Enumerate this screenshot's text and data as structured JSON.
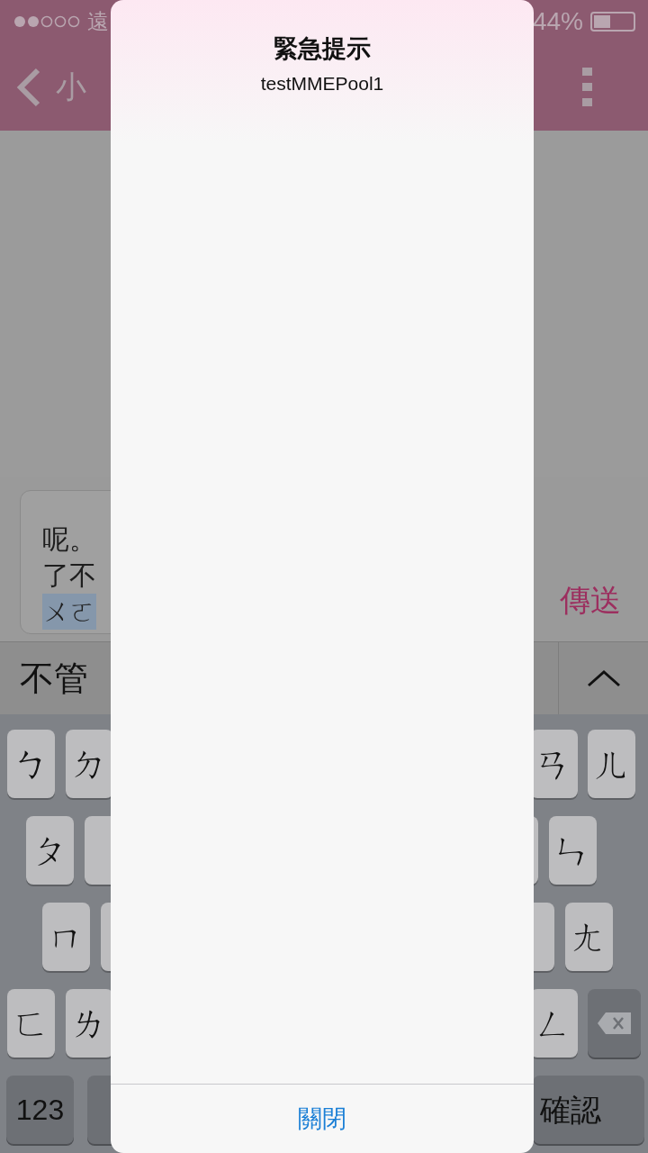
{
  "status_bar": {
    "carrier": "遠",
    "battery": "44%"
  },
  "nav": {
    "title": "小"
  },
  "composer": {
    "lines": [
      "呢。",
      "了不"
    ],
    "composing": "ㄨㄛ",
    "send": "傳送"
  },
  "candidates": {
    "items": [
      "不管"
    ]
  },
  "keyboard": {
    "rows": [
      {
        "left": [
          "ㄅ",
          "ㄉ"
        ],
        "right": [
          "ㄢ",
          "ㄦ"
        ]
      },
      {
        "left": [
          "ㄆ"
        ],
        "right": [
          "ㄣ"
        ]
      },
      {
        "left": [
          "ㄇ"
        ],
        "right": [
          "ㄤ"
        ]
      },
      {
        "left": [
          "ㄈ",
          "ㄌ"
        ],
        "right": [
          "ㄥ"
        ]
      }
    ],
    "bottom": {
      "numbers": "123",
      "confirm": "確認"
    }
  },
  "alert": {
    "title": "緊急提示",
    "message": "testMMEPool1",
    "button": "關閉"
  }
}
